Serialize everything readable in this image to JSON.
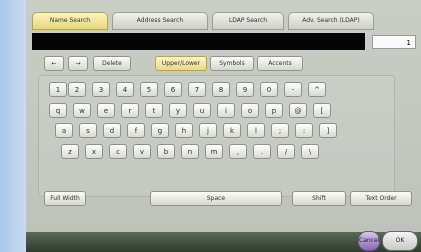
{
  "tabs": [
    {
      "label": "Name Search"
    },
    {
      "label": "Address Search"
    },
    {
      "label": "LDAP Search"
    },
    {
      "label": "Adv. Search (LDAP)"
    }
  ],
  "input": {
    "value": "",
    "count": "1"
  },
  "controls": {
    "left_arrow": "←",
    "right_arrow": "→",
    "delete": "Delete",
    "upper_lower": "Upper/Lower",
    "symbols": "Symbols",
    "accent": "Accents"
  },
  "keyboard": {
    "row1": [
      "1",
      "2",
      "3",
      "4",
      "5",
      "6",
      "7",
      "8",
      "9",
      "0",
      "-",
      "^"
    ],
    "row2": [
      "q",
      "w",
      "e",
      "r",
      "t",
      "y",
      "u",
      "i",
      "o",
      "p",
      "@",
      "["
    ],
    "row3": [
      "a",
      "s",
      "d",
      "f",
      "g",
      "h",
      "j",
      "k",
      "l",
      ";",
      ":",
      "]"
    ],
    "row4": [
      "z",
      "x",
      "c",
      "v",
      "b",
      "n",
      "m",
      ",",
      ".",
      "/",
      "\\"
    ]
  },
  "bottom": {
    "full_width": "Full Width",
    "space": "Space",
    "shift": "Shift",
    "text_order": "Text Order"
  },
  "footer": {
    "cancel": "Cancel",
    "ok": "OK"
  }
}
